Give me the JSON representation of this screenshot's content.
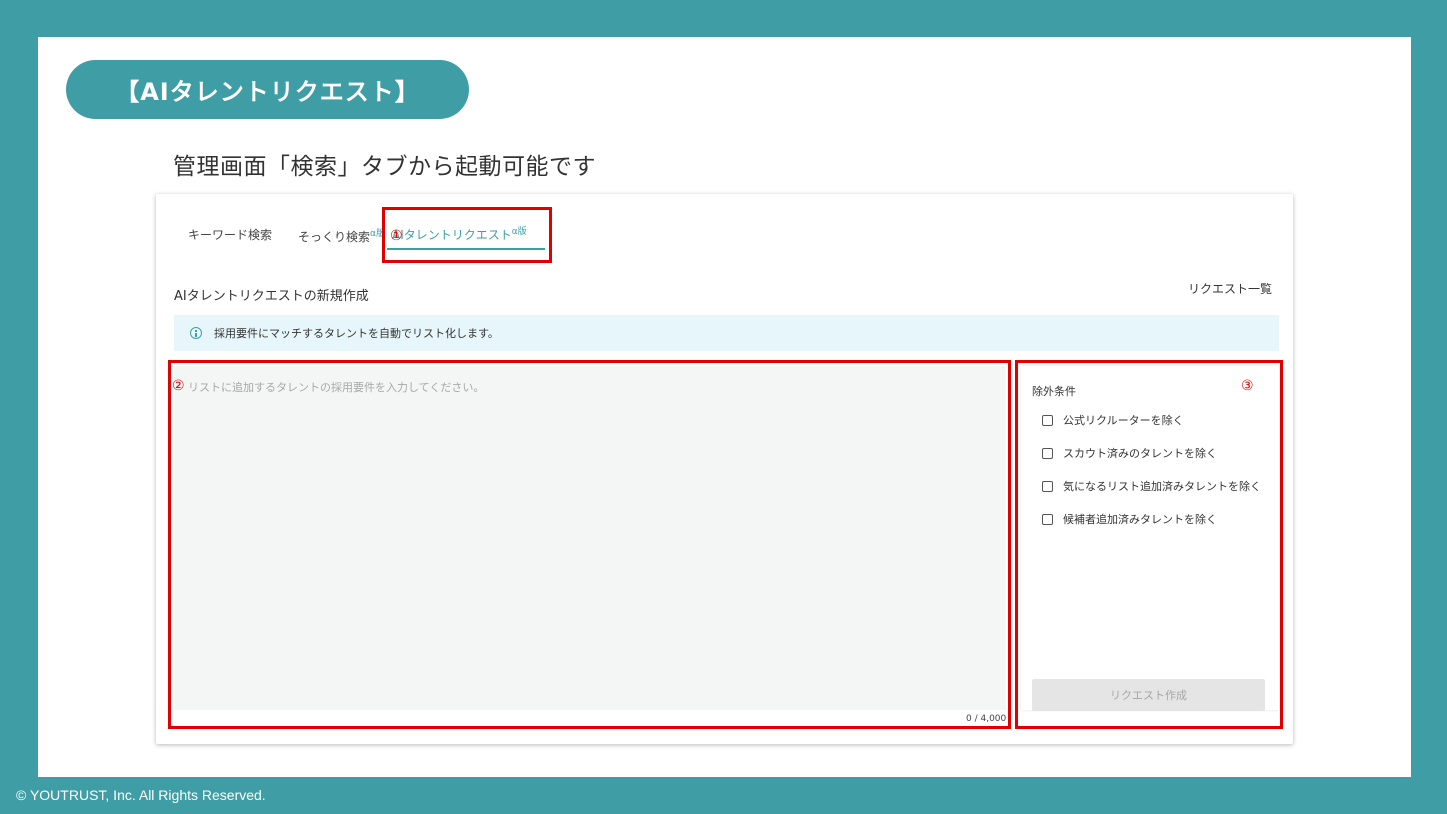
{
  "slide": {
    "heading": "【AIタレントリクエスト】",
    "subtitle": "管理画面「検索」タブから起動可能です",
    "copyright": "© YOUTRUST, Inc. All Rights Reserved."
  },
  "tabs": [
    {
      "label": "キーワード検索",
      "badge": ""
    },
    {
      "label": "そっくり検索",
      "badge": "α版"
    },
    {
      "label": "AIタレントリクエスト",
      "badge": "α版",
      "active": true
    }
  ],
  "annotations": {
    "one": "①",
    "two": "②",
    "three": "③"
  },
  "form": {
    "section_title": "AIタレントリクエストの新規作成",
    "request_list_link": "リクエスト一覧",
    "info_text": "採用要件にマッチするタレントを自動でリスト化します。",
    "textarea_placeholder": "リストに追加するタレントの採用要件を入力してください。",
    "textarea_value": "",
    "counter": "0 / 4,000"
  },
  "exclusions": {
    "title": "除外条件",
    "options": [
      {
        "label": "公式リクルーターを除く",
        "checked": false
      },
      {
        "label": "スカウト済みのタレントを除く",
        "checked": false
      },
      {
        "label": "気になるリスト追加済みタレントを除く",
        "checked": false
      },
      {
        "label": "候補者追加済みタレントを除く",
        "checked": false
      }
    ],
    "submit_label": "リクエスト作成"
  },
  "colors": {
    "brand": "#3f9ea5",
    "annotation": "#e00000",
    "info_bg": "#e6f6fb"
  }
}
